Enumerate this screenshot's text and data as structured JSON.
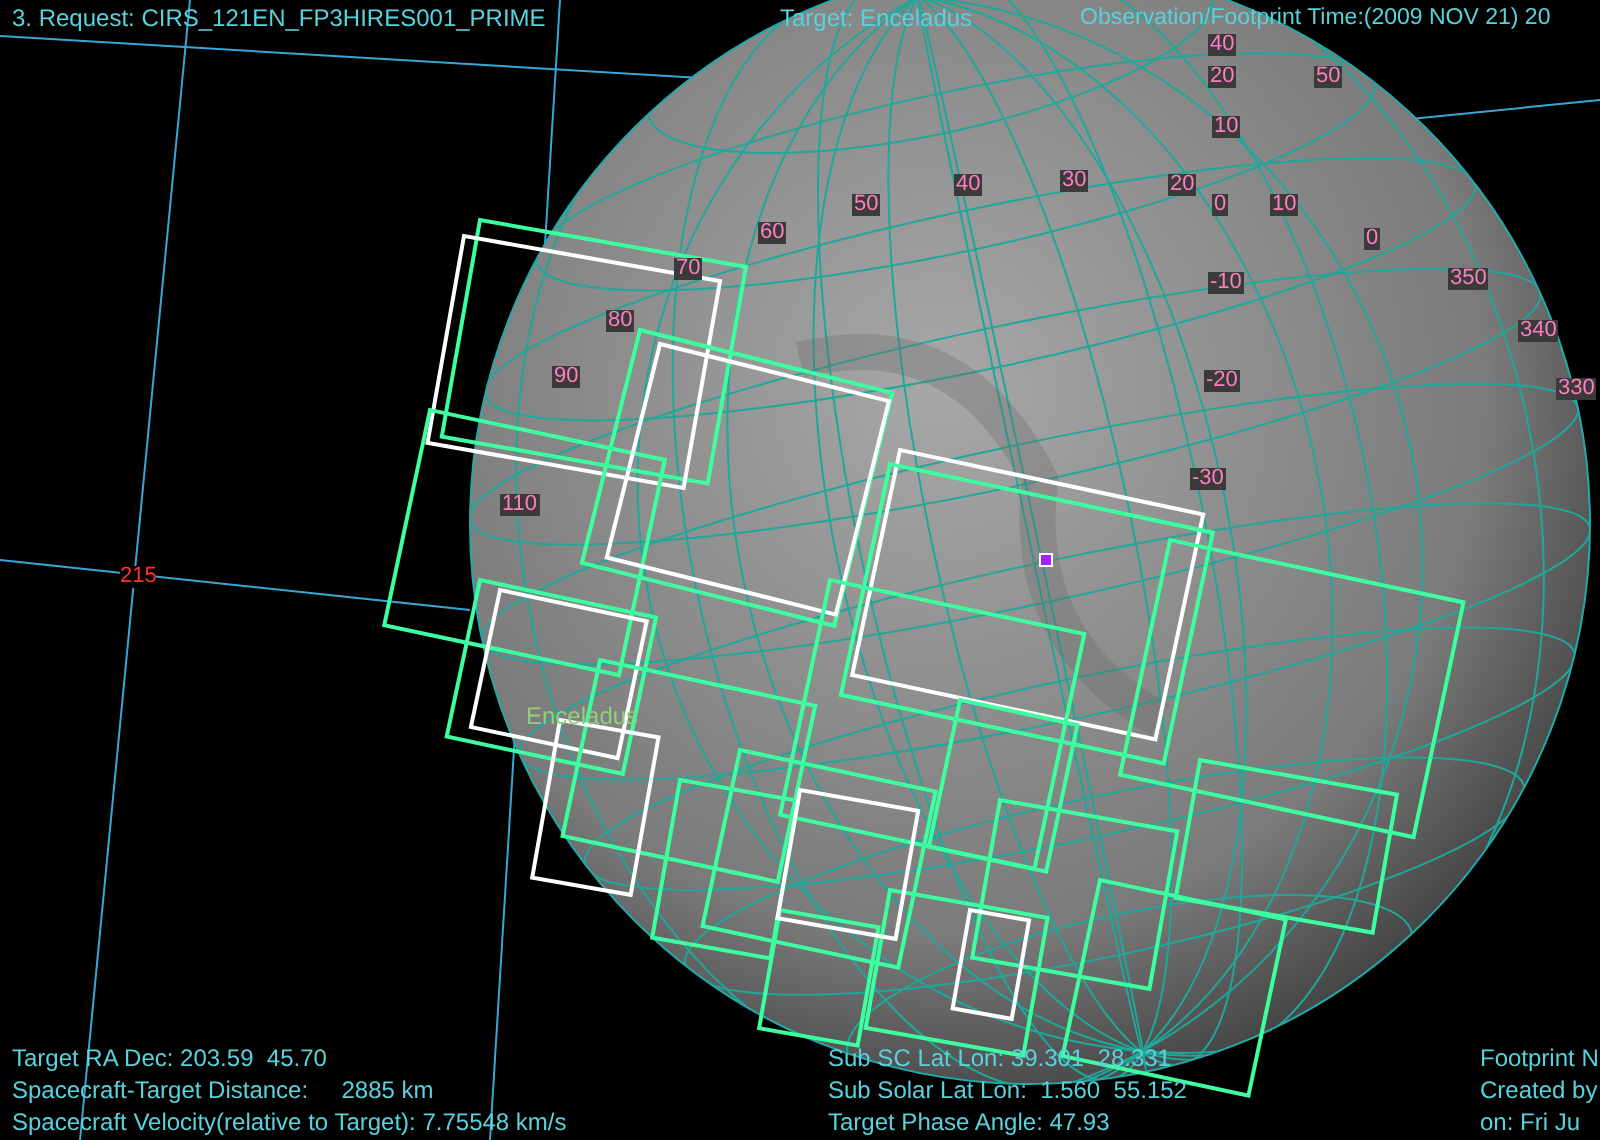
{
  "header": {
    "request": "3. Request: CIRS_121EN_FP3HIRES001_PRIME",
    "target": "Target: Enceladus",
    "time": "Observation/Footprint Time:(2009 NOV 21) 20"
  },
  "grid_labels": [
    {
      "text": "40",
      "kind": "body"
    },
    {
      "text": "20",
      "kind": "body"
    },
    {
      "text": "50",
      "kind": "body"
    },
    {
      "text": "10",
      "kind": "body"
    },
    {
      "text": "50",
      "kind": "body"
    },
    {
      "text": "40",
      "kind": "body"
    },
    {
      "text": "30",
      "kind": "body"
    },
    {
      "text": "20",
      "kind": "body"
    },
    {
      "text": "0",
      "kind": "body"
    },
    {
      "text": "10",
      "kind": "body"
    },
    {
      "text": "60",
      "kind": "body"
    },
    {
      "text": "0",
      "kind": "body"
    },
    {
      "text": "70",
      "kind": "body"
    },
    {
      "text": "-10",
      "kind": "body"
    },
    {
      "text": "350",
      "kind": "body"
    },
    {
      "text": "80",
      "kind": "body"
    },
    {
      "text": "340",
      "kind": "body"
    },
    {
      "text": "90",
      "kind": "body"
    },
    {
      "text": "-20",
      "kind": "body"
    },
    {
      "text": "330",
      "kind": "body"
    },
    {
      "text": "-30",
      "kind": "body"
    },
    {
      "text": "110",
      "kind": "body"
    },
    {
      "text": "215",
      "kind": "sky"
    }
  ],
  "body_label": "Enceladus",
  "footer": {
    "left": [
      "Target RA Dec: 203.59  45.70",
      "Spacecraft-Target Distance:     2885 km",
      "Spacecraft Velocity(relative to Target): 7.75548 km/s"
    ],
    "middle": [
      "Sub SC Lat Lon: 39.301  28.331",
      "Sub Solar Lat Lon:  1.560  55.152",
      "Target Phase Angle: 47.93"
    ],
    "right": [
      "Footprint N",
      "Created by",
      "on: Fri Ju"
    ]
  }
}
